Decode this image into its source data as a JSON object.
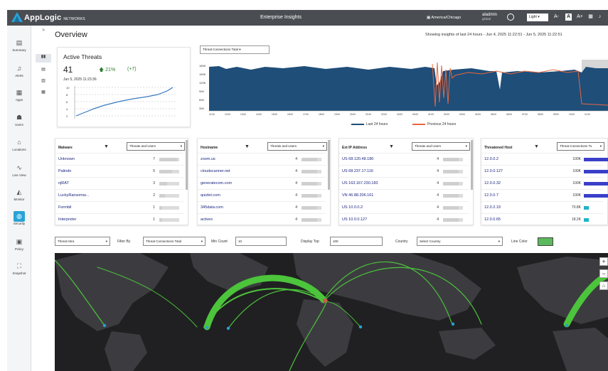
{
  "topbar": {
    "brand": "AppLogic",
    "brand_sub": "NETWORKS",
    "title": "Enterprise Insights",
    "timezone": "America/Chicago",
    "user_name": "aladmin",
    "user_role": "global",
    "theme": "Light",
    "icon_buttons": [
      "A-",
      "A",
      "A+",
      "grid",
      "bell",
      "help"
    ]
  },
  "sidebar": {
    "items": [
      {
        "label": "Summary",
        "icon": "summary-icon",
        "glyph": "▤"
      },
      {
        "label": "Alerts",
        "icon": "bell-icon",
        "glyph": "♫"
      },
      {
        "label": "Apps",
        "icon": "apps-icon",
        "glyph": "▦"
      },
      {
        "label": "Users",
        "icon": "users-icon",
        "glyph": "☗"
      },
      {
        "label": "Locations",
        "icon": "location-icon",
        "glyph": "⌂"
      },
      {
        "label": "Live View",
        "icon": "live-view-icon",
        "glyph": "∿"
      },
      {
        "label": "Monitor",
        "icon": "monitor-icon",
        "glyph": "◭"
      },
      {
        "label": "Security",
        "icon": "security-icon",
        "glyph": "◍"
      },
      {
        "label": "Policy",
        "icon": "policy-icon",
        "glyph": "▣"
      },
      {
        "label": "Snapshot",
        "icon": "snapshot-icon",
        "glyph": "⛶"
      }
    ],
    "active": "Security",
    "subnav": [
      ">",
      "▮▮",
      "▤",
      "▥",
      "▦"
    ]
  },
  "overview": {
    "title": "Overview",
    "range": "Showing insights of last 24 hours - Jun 4, 2025 11:22:51 - Jun 5, 2025 11:22:51"
  },
  "threat_card": {
    "title": "Active Threats",
    "value": "41",
    "change_pct": "21%",
    "change_abs": "(+7)",
    "timestamp": "Jun 5, 2025 11:23:36",
    "y_ticks": [
      "10",
      "8",
      "6",
      "4",
      "2",
      "0"
    ]
  },
  "main_chart": {
    "metric_select": "Threat Connections Total",
    "y_ticks": [
      "180K",
      "150K",
      "120K",
      "90K",
      "60K",
      "30K",
      "0"
    ],
    "x_ticks": [
      "11:00",
      "12:00",
      "13:00",
      "14:00",
      "15:00",
      "16:00",
      "17:00",
      "18:00",
      "19:00",
      "20:00",
      "21:00",
      "22:00",
      "23:00",
      "00:00",
      "01:00",
      "02:00",
      "03:00",
      "04:00",
      "05:00",
      "06:00",
      "07:00",
      "08:00",
      "09:00",
      "10:00",
      "11:00"
    ],
    "legend": [
      {
        "name": "Last 24 hours",
        "color": "#1f4e79"
      },
      {
        "name": "Previous 24 hours",
        "color": "#e8663d"
      }
    ]
  },
  "tables": [
    {
      "header": "Malware",
      "select": "Threats and Users",
      "rows": [
        {
          "name": "Unknown",
          "count": "7",
          "frac": 0.9
        },
        {
          "name": "Palindo",
          "count": "5",
          "frac": 0.65
        },
        {
          "name": "njRAT",
          "count": "3",
          "frac": 0.4
        },
        {
          "name": "LuckyRansomw...",
          "count": "2",
          "frac": 0.28
        },
        {
          "name": "Formbil",
          "count": "1",
          "frac": 0.15
        },
        {
          "name": "Interpreter",
          "count": "1",
          "frac": 0.15
        }
      ]
    },
    {
      "header": "Hostname",
      "select": "Threats and Users",
      "rows": [
        {
          "name": "zoom.us",
          "count": "4",
          "frac": 0.8
        },
        {
          "name": "cloudscanner.net",
          "count": "4",
          "frac": 0.8
        },
        {
          "name": "generatecom.com",
          "count": "4",
          "frac": 0.8
        },
        {
          "name": "quizlet.com",
          "count": "4",
          "frac": 0.8
        },
        {
          "name": "345data.com",
          "count": "4",
          "frac": 0.8
        },
        {
          "name": "activex",
          "count": "4",
          "frac": 0.8
        }
      ]
    },
    {
      "header": "Ext IP Address",
      "select": "Threats and Users",
      "rows": [
        {
          "name": "US  68.120.48.180",
          "count": "4",
          "frac": 0.8
        },
        {
          "name": "US  68.237.17.116",
          "count": "4",
          "frac": 0.8
        },
        {
          "name": "US  163.167.230.183",
          "count": "4",
          "frac": 0.8
        },
        {
          "name": "VN  46.88.206.161",
          "count": "4",
          "frac": 0.8
        },
        {
          "name": "US  10.0.0.2",
          "count": "4",
          "frac": 0.8
        },
        {
          "name": "US  10.0.0.127",
          "count": "4",
          "frac": 0.8
        }
      ]
    },
    {
      "header": "Threatened Host",
      "select": "Threat Connections To",
      "rows": [
        {
          "name": "12.0.0.2",
          "count": "100K",
          "frac": 1.0
        },
        {
          "name": "12.0.0.127",
          "count": "100K",
          "frac": 1.0
        },
        {
          "name": "12.0.0.32",
          "count": "100K",
          "frac": 1.0
        },
        {
          "name": "12.0.0.7",
          "count": "100K",
          "frac": 1.0
        },
        {
          "name": "12.0.2.19",
          "count": "70.8K",
          "frac": 0.2
        },
        {
          "name": "12.0.0.65",
          "count": "18.2K",
          "frac": 0.2
        }
      ]
    }
  ],
  "filters": {
    "view": "Threat Intra",
    "filter_by_label": "Filter By",
    "filter_by": "Threat Connections Total",
    "min_count_label": "Min Count",
    "min_count": "10",
    "display_top_label": "Display Top",
    "display_top": "100",
    "country_label": "Country",
    "country": "Select Country",
    "line_color_label": "Line Color",
    "line_color": "#5cb85c"
  },
  "map": {
    "zoom_in": "+",
    "zoom_out": "−",
    "home": "⌂"
  }
}
